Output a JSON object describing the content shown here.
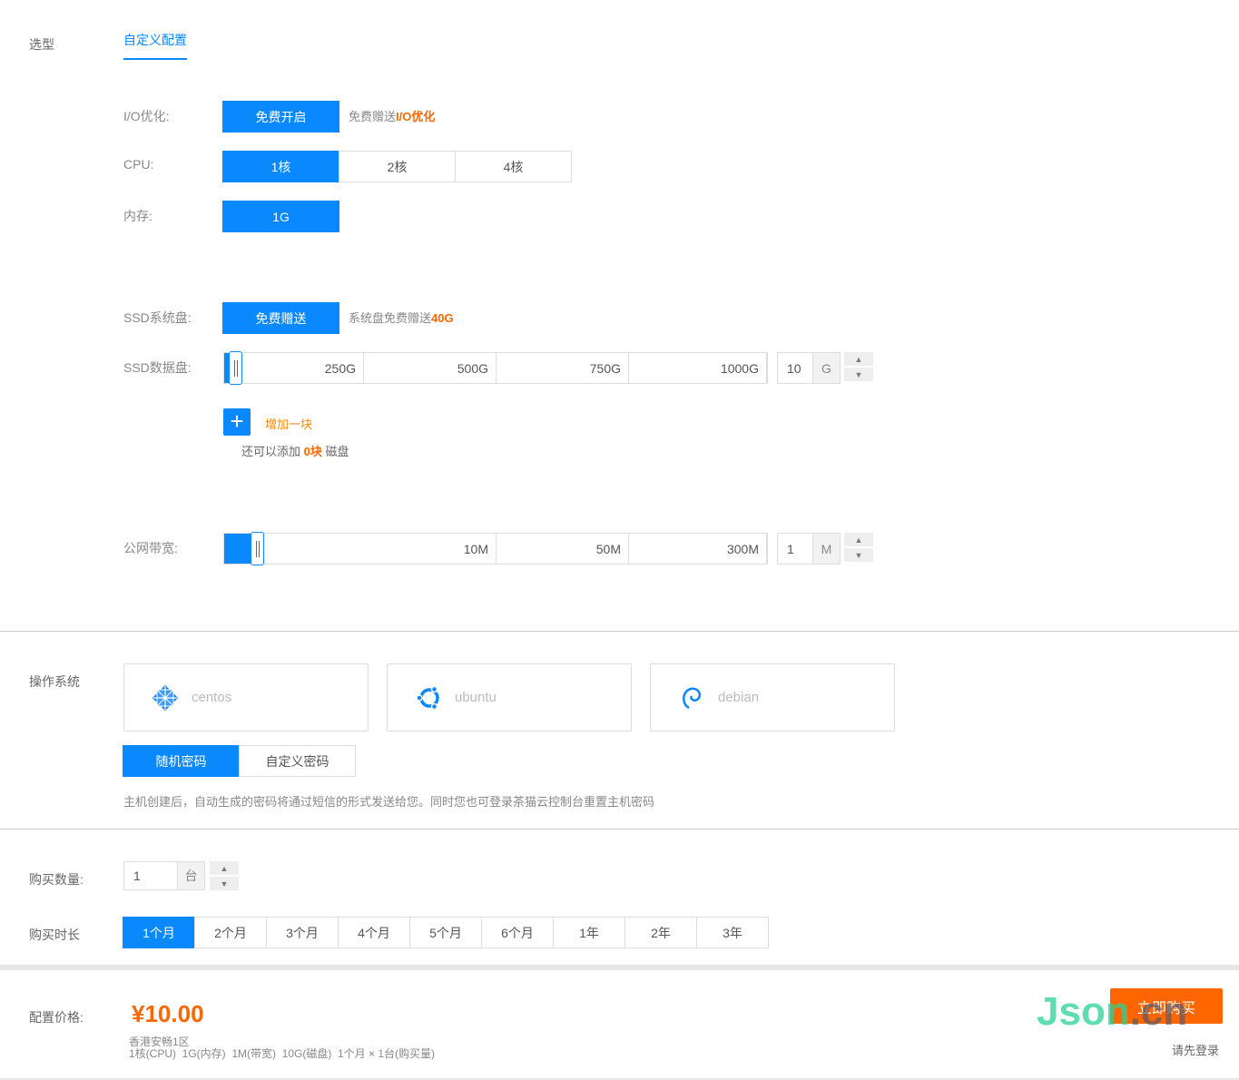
{
  "section_model": {
    "label": "选型",
    "tab": "自定义配置"
  },
  "io": {
    "label": "I/O优化:",
    "button": "免费开启",
    "hint_prefix": "免费赠送",
    "hint_emph": "I/O优化"
  },
  "cpu": {
    "label": "CPU:",
    "options": [
      "1核",
      "2核",
      "4核"
    ]
  },
  "memory": {
    "label": "内存:",
    "options": [
      "1G"
    ]
  },
  "ssd_system": {
    "label": "SSD系统盘:",
    "button": "免费赠送",
    "hint_prefix": "系统盘免费赠送",
    "hint_emph": "40G"
  },
  "ssd_data": {
    "label": "SSD数据盘:",
    "ticks": [
      "250G",
      "500G",
      "750G",
      "1000G"
    ],
    "value": "10",
    "unit": "G",
    "add_label": "增加一块",
    "remain_prefix": "还可以添加",
    "remain_emph": "0块",
    "remain_suffix": "磁盘"
  },
  "bandwidth": {
    "label": "公网带宽:",
    "ticks": [
      "10M",
      "50M",
      "300M"
    ],
    "value": "1",
    "unit": "M"
  },
  "os": {
    "label": "操作系统",
    "options": [
      "centos",
      "ubuntu",
      "debian"
    ]
  },
  "password": {
    "options": [
      "随机密码",
      "自定义密码"
    ],
    "note": "主机创建后，自动生成的密码将通过短信的形式发送给您。同时您也可登录茶猫云控制台重置主机密码"
  },
  "quantity": {
    "label": "购买数量:",
    "value": "1",
    "unit": "台"
  },
  "duration": {
    "label": "购买时长",
    "options": [
      "1个月",
      "2个月",
      "3个月",
      "4个月",
      "5个月",
      "6个月",
      "1年",
      "2年",
      "3年"
    ]
  },
  "footer": {
    "price_label": "配置价格:",
    "price": "¥10.00",
    "region": "香港安畅1区",
    "summary": "1核(CPU)  1G(内存)  1M(带宽)  10G(磁盘)  1个月 × 1台(购买量)",
    "buy": "立即购买",
    "login": "请先登录",
    "watermark": "Json.cn"
  },
  "colors": {
    "accent": "#0a89ff",
    "orange": "#ff6600"
  }
}
